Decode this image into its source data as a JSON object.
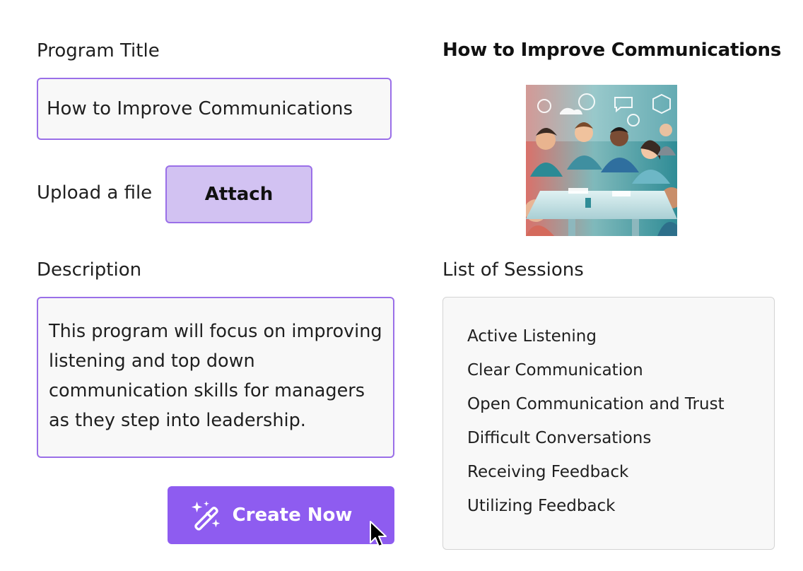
{
  "form": {
    "title_label": "Program Title",
    "title_value": "How to Improve Communications",
    "upload_label": "Upload a file",
    "attach_label": "Attach",
    "description_label": "Description",
    "description_value": "This program will focus on improving listening and top down communication skills for managers as they step into leadership.",
    "create_label": "Create Now"
  },
  "preview": {
    "title": "How to Improve Communications",
    "image_description_icon": "team-meeting-illustration"
  },
  "sessions": {
    "label": "List of Sessions",
    "items": [
      "Active Listening",
      "Clear Communication",
      "Open Communication and Trust",
      "Difficult Conversations",
      "Receiving Feedback",
      "Utilizing Feedback"
    ]
  },
  "colors": {
    "accent": "#8e5cf0",
    "accent_light": "#d2c2f2",
    "border_accent": "#9a6fe8",
    "field_bg": "#f8f8f8"
  }
}
